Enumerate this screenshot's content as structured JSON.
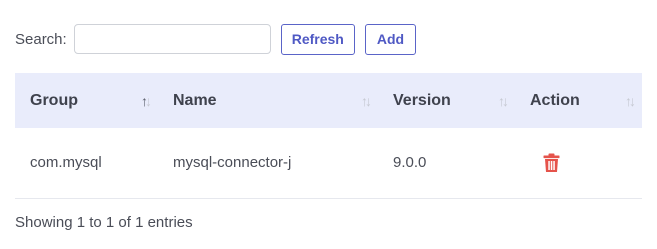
{
  "search": {
    "label": "Search:",
    "value": "",
    "placeholder": ""
  },
  "buttons": {
    "refresh": "Refresh",
    "add": "Add"
  },
  "table": {
    "columns": [
      "Group",
      "Name",
      "Version",
      "Action"
    ],
    "rows": [
      {
        "group": "com.mysql",
        "name": "mysql-connector-j",
        "version": "9.0.0",
        "action_icon": "trash-icon"
      }
    ]
  },
  "footer": {
    "info": "Showing 1 to 1 of 1 entries"
  },
  "colors": {
    "accent": "#4f59c4",
    "header_bg": "#e9ecfb",
    "delete": "#e5534b"
  }
}
